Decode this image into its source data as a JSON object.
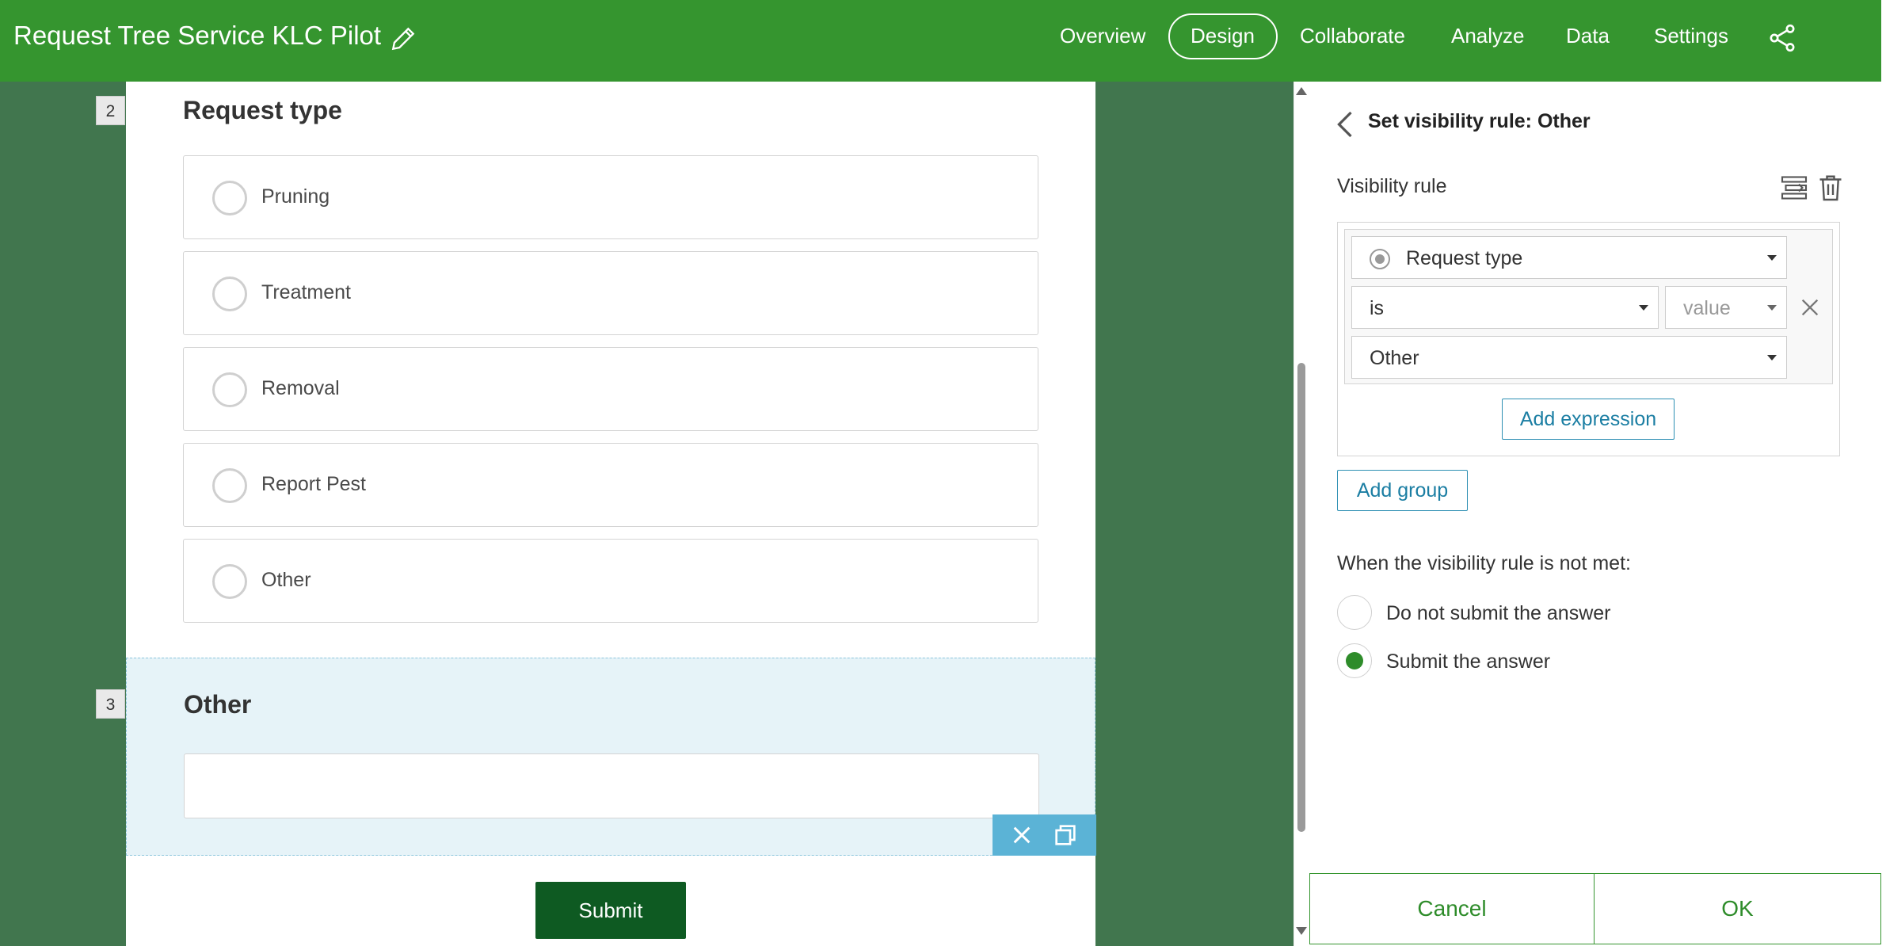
{
  "header": {
    "title": "Request Tree Service KLC Pilot",
    "nav": [
      "Overview",
      "Design",
      "Collaborate",
      "Analyze",
      "Data",
      "Settings"
    ],
    "active_tab": "Design",
    "bg_color": "#35952f"
  },
  "form": {
    "questions": [
      {
        "number": "2",
        "title": "Request type",
        "options": [
          "Pruning",
          "Treatment",
          "Removal",
          "Report Pest",
          "Other"
        ]
      },
      {
        "number": "3",
        "title": "Other"
      }
    ],
    "submit_label": "Submit"
  },
  "panel": {
    "title": "Set visibility rule: Other",
    "rule_label": "Visibility rule",
    "expression": {
      "question": "Request type",
      "operator": "is",
      "value_type": "value",
      "value": "Other"
    },
    "add_expression": "Add expression",
    "add_group": "Add group",
    "not_met_label": "When the visibility rule is not met:",
    "options": [
      {
        "label": "Do not submit the answer",
        "checked": false
      },
      {
        "label": "Submit the answer",
        "checked": true
      }
    ],
    "cancel": "Cancel",
    "ok": "OK"
  }
}
